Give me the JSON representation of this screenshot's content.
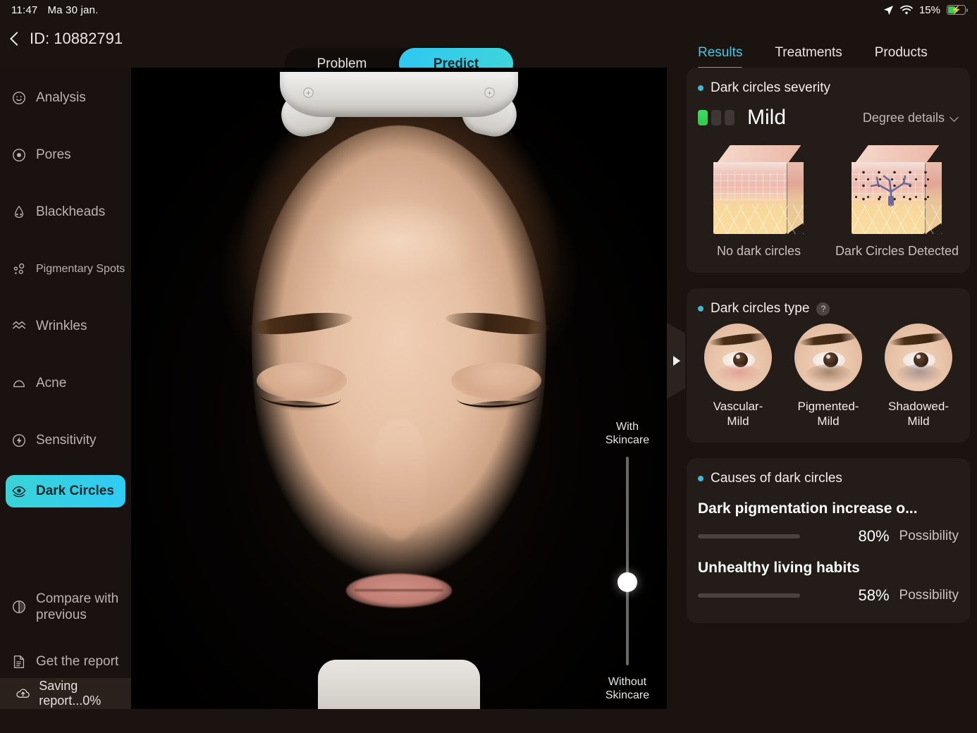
{
  "status_bar": {
    "time": "11:47",
    "date": "Ma 30 jan.",
    "battery_percent": "15%",
    "icons": [
      "location-arrow-icon",
      "wifi-icon",
      "battery-charging-icon"
    ]
  },
  "header": {
    "back_label": "ID: 10882791",
    "segmented": {
      "options": [
        "Problem",
        "Predict"
      ],
      "selected": "Predict"
    }
  },
  "tabs": {
    "items": [
      "Results",
      "Treatments",
      "Products"
    ],
    "selected": "Results"
  },
  "sidebar": {
    "items": [
      {
        "label": "Analysis",
        "icon": "face-smile-icon",
        "active": false
      },
      {
        "label": "Pores",
        "icon": "pore-circle-icon",
        "active": false
      },
      {
        "label": "Blackheads",
        "icon": "nose-icon",
        "active": false
      },
      {
        "label": "Pigmentary Spots",
        "icon": "spots-icon",
        "active": false
      },
      {
        "label": "Wrinkles",
        "icon": "waves-icon",
        "active": false
      },
      {
        "label": "Acne",
        "icon": "acne-bump-icon",
        "active": false
      },
      {
        "label": "Sensitivity",
        "icon": "bolt-circle-icon",
        "active": false
      },
      {
        "label": "Dark Circles",
        "icon": "eye-icon",
        "active": true
      }
    ],
    "bottom_items": [
      {
        "label": "Compare with previous",
        "icon": "contrast-circle-icon"
      },
      {
        "label": "Get the report",
        "icon": "document-icon"
      }
    ],
    "saving": {
      "label": "Saving report...0%",
      "icon": "cloud-upload-icon"
    }
  },
  "viewer": {
    "slider": {
      "top_label": "With Skincare",
      "bottom_label": "Without Skincare",
      "handle_position_percent": 60
    },
    "panel_handle_icon": "triangle-right-icon"
  },
  "results": {
    "severity_card": {
      "title": "Dark circles severity",
      "level_label": "Mild",
      "level_index": 1,
      "level_total": 3,
      "level_color": "#2fc94e",
      "details_link": "Degree details",
      "details_icon": "chevron-down-icon",
      "diagrams": [
        {
          "caption": "No dark circles",
          "variant": "normal"
        },
        {
          "caption": "Dark Circles Detected",
          "variant": "detected"
        }
      ]
    },
    "type_card": {
      "title": "Dark circles type",
      "help_icon": "question-mark-icon",
      "types": [
        {
          "label": "Vascular-\nMild",
          "label_line1": "Vascular-",
          "label_line2": "Mild",
          "variant": "vascular"
        },
        {
          "label": "Pigmented-\nMild",
          "label_line1": "Pigmented-",
          "label_line2": "Mild",
          "variant": "pigmented"
        },
        {
          "label": "Shadowed-\nMild",
          "label_line1": "Shadowed-",
          "label_line2": "Mild",
          "variant": "shadowed"
        }
      ]
    },
    "causes_card": {
      "title": "Causes of dark circles",
      "possibility_label": "Possibility",
      "items": [
        {
          "name": "Dark pigmentation increase o...",
          "percent": "80%",
          "value": 80
        },
        {
          "name": "Unhealthy living habits",
          "percent": "58%",
          "value": 58
        }
      ]
    }
  },
  "colors": {
    "accent_cyan": "#2fcbf4",
    "accent_teal": "#3ad3d8",
    "bullet": "#3fb8d2",
    "severity_green": "#2fc94e",
    "progress_orange": "#e8763a",
    "panel_bg": "#241c19",
    "app_bg": "#1a1310"
  }
}
